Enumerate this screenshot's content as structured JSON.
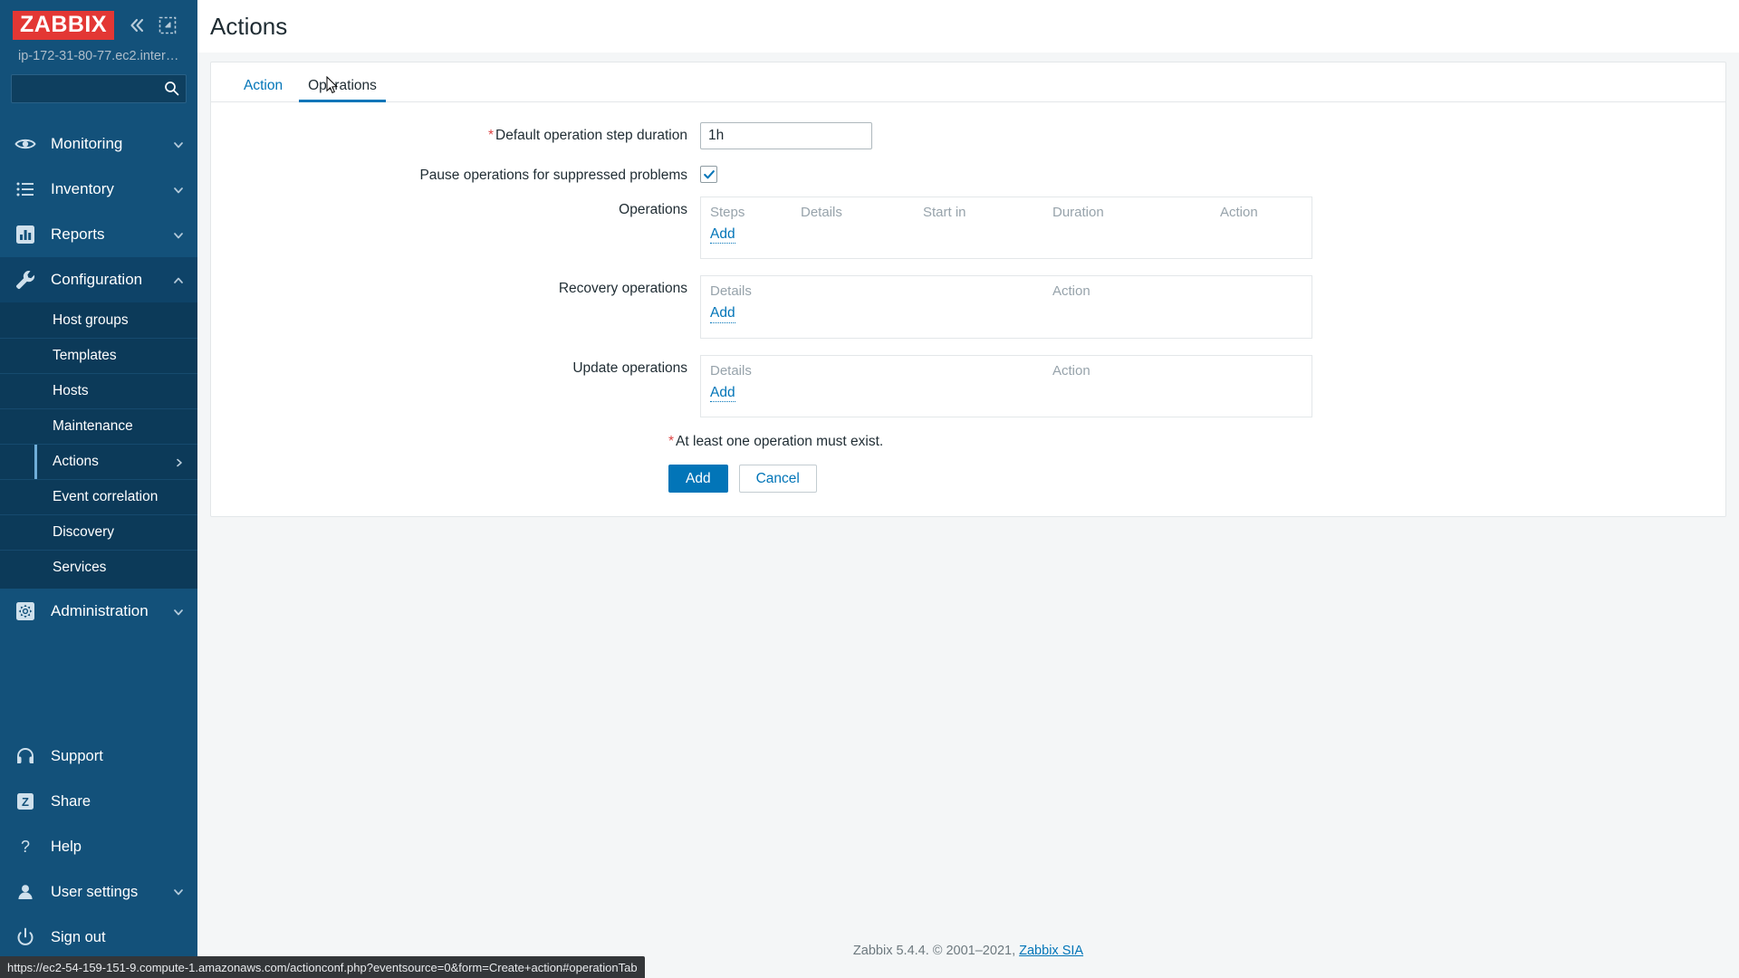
{
  "brand": {
    "logo_text": "ZABBIX",
    "logo_bg": "#e33734",
    "host_name": "ip-172-31-80-77.ec2.inter…"
  },
  "search": {
    "value": "",
    "placeholder": ""
  },
  "sidebar": {
    "nav": [
      {
        "label": "Monitoring",
        "icon": "eye-icon",
        "chevron": "down",
        "active": false
      },
      {
        "label": "Inventory",
        "icon": "list-icon",
        "chevron": "down",
        "active": false
      },
      {
        "label": "Reports",
        "icon": "bar-chart-icon",
        "chevron": "down",
        "active": false
      },
      {
        "label": "Configuration",
        "icon": "wrench-icon",
        "chevron": "up",
        "active": true
      }
    ],
    "submenu": [
      {
        "label": "Host groups",
        "selected": false,
        "chevron": false
      },
      {
        "label": "Templates",
        "selected": false,
        "chevron": false
      },
      {
        "label": "Hosts",
        "selected": false,
        "chevron": false
      },
      {
        "label": "Maintenance",
        "selected": false,
        "chevron": false
      },
      {
        "label": "Actions",
        "selected": true,
        "chevron": true
      },
      {
        "label": "Event correlation",
        "selected": false,
        "chevron": false
      },
      {
        "label": "Discovery",
        "selected": false,
        "chevron": false
      },
      {
        "label": "Services",
        "selected": false,
        "chevron": false
      }
    ],
    "administration": {
      "label": "Administration",
      "icon": "gear-icon",
      "chevron": "down"
    },
    "bottom": [
      {
        "label": "Support",
        "icon": "headset-icon",
        "chevron": false
      },
      {
        "label": "Share",
        "icon": "zabbix-share-icon",
        "chevron": false
      },
      {
        "label": "Help",
        "icon": "question-icon",
        "chevron": false
      },
      {
        "label": "User settings",
        "icon": "user-icon",
        "chevron": true
      },
      {
        "label": "Sign out",
        "icon": "power-icon",
        "chevron": false
      }
    ]
  },
  "header": {
    "title": "Actions"
  },
  "tabs": [
    {
      "label": "Action",
      "active": false
    },
    {
      "label": "Operations",
      "active": true
    }
  ],
  "form": {
    "default_step_duration": {
      "label": "Default operation step duration",
      "required": true,
      "value": "1h"
    },
    "pause_suppressed": {
      "label": "Pause operations for suppressed problems",
      "checked": true
    },
    "operations": {
      "label": "Operations",
      "columns": [
        "Steps",
        "Details",
        "Start in",
        "Duration",
        "Action"
      ],
      "rows": [],
      "add_label": "Add"
    },
    "recovery_operations": {
      "label": "Recovery operations",
      "columns": [
        "Details",
        "Action"
      ],
      "rows": [],
      "add_label": "Add"
    },
    "update_operations": {
      "label": "Update operations",
      "columns": [
        "Details",
        "Action"
      ],
      "rows": [],
      "add_label": "Add"
    },
    "validation_message": "At least one operation must exist.",
    "buttons": {
      "submit": "Add",
      "cancel": "Cancel"
    }
  },
  "footer": {
    "text": "Zabbix 5.4.4. © 2001–2021,",
    "link": "Zabbix SIA"
  },
  "statusbar": {
    "url": "https://ec2-54-159-151-9.compute-1.amazonaws.com/actionconf.php?eventsource=0&form=Create+action#operationTab"
  },
  "colors": {
    "sidebar_bg": "#13517a",
    "submenu_bg": "#0c3a59",
    "accent": "#0275b8",
    "required": "#d44444",
    "brand_red": "#e33734"
  }
}
